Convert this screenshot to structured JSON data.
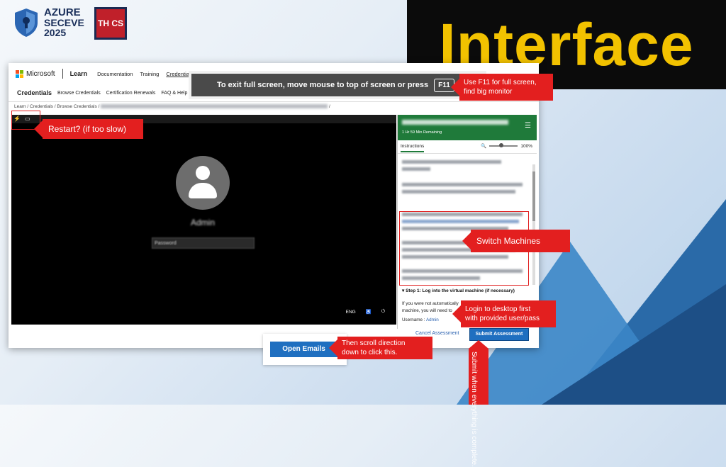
{
  "logos": {
    "azure": {
      "line1": "AZURE",
      "line2": "SECEVE",
      "line3": "2025"
    },
    "thcs": "TH CS"
  },
  "banner": {
    "title": "Interface"
  },
  "learn": {
    "brand": "Microsoft",
    "section": "Learn",
    "nav": [
      "Documentation",
      "Training",
      "Credentials",
      "C"
    ],
    "cred_title": "Credentials",
    "cred_nav": [
      "Browse Credentials",
      "Certification Renewals",
      "FAQ & Help"
    ],
    "crumbs": [
      "Learn",
      "Credentials",
      "Browse Credentials"
    ]
  },
  "fullscreen": {
    "message": "To exit full screen, move mouse to top of screen or press",
    "key": "F11"
  },
  "vm": {
    "user": "Admin",
    "password_placeholder": "Password",
    "tray": {
      "lang": "ENG"
    }
  },
  "panel": {
    "time_remaining": "1 Hr 59 Min Remaining",
    "tab": "Instructions",
    "zoom": "100%",
    "step1": "Step 1: Log into the virtual machine (if necessary)",
    "step_text_1": "If you were not automatically",
    "step_text_2": "machine, you will need to",
    "username_label": "Username :",
    "username_value": "Admin",
    "cancel": "Cancel Assessment",
    "submit": "Submit Assessment"
  },
  "open_emails": "Open Emails",
  "callouts": {
    "restart": "Restart? (if too slow)",
    "f11_line1": "Use F11 for full screen,",
    "f11_line2": "find big monitor",
    "switch": "Switch Machines",
    "login_line1": "Login to desktop first",
    "login_line2": "with provided user/pass",
    "scroll_line1": "Then scroll direction",
    "scroll_line2": "down to click this.",
    "submit": "Submit when everything is complete."
  },
  "colors": {
    "banner_text": "#f2c200",
    "callout": "#e31f1f",
    "panel_header": "#1f7a3a",
    "button_blue": "#1f6fc0"
  }
}
